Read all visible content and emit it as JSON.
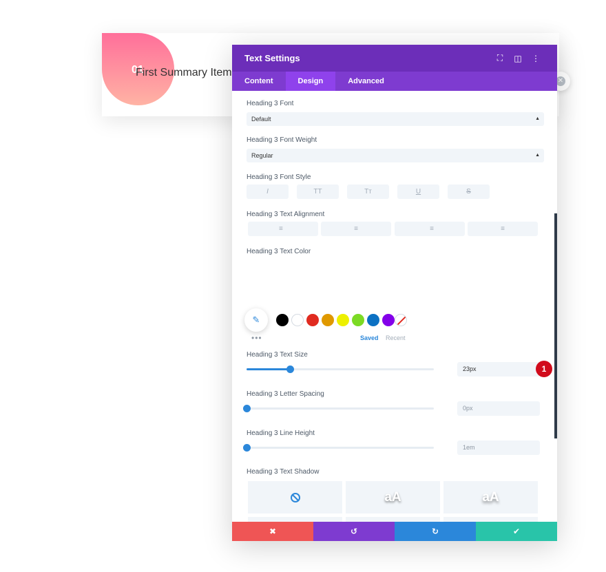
{
  "card": {
    "number": "01",
    "title": "First Summary Item",
    "close_glyph": "✕"
  },
  "modal": {
    "title": "Text Settings",
    "header_icons": [
      "expand-icon",
      "sidebar-icon",
      "more-icon"
    ],
    "header_glyphs": {
      "expand": "⛶",
      "sidebar": "◫",
      "more": "⋮"
    },
    "tabs": [
      {
        "label": "Content",
        "active": false
      },
      {
        "label": "Design",
        "active": true
      },
      {
        "label": "Advanced",
        "active": false
      }
    ]
  },
  "fields": {
    "font": {
      "label": "Heading 3 Font",
      "value": "Default"
    },
    "weight": {
      "label": "Heading 3 Font Weight",
      "value": "Regular"
    },
    "style": {
      "label": "Heading 3 Font Style",
      "options": [
        {
          "name": "italic",
          "glyph": "I"
        },
        {
          "name": "uppercase",
          "glyph": "TT"
        },
        {
          "name": "capitalize",
          "glyph": "Tт"
        },
        {
          "name": "underline",
          "glyph": "U"
        },
        {
          "name": "strikethrough",
          "glyph": "S"
        }
      ]
    },
    "alignment": {
      "label": "Heading 3 Text Alignment",
      "options": [
        {
          "name": "left",
          "glyph": "≡"
        },
        {
          "name": "center",
          "glyph": "≡"
        },
        {
          "name": "right",
          "glyph": "≡"
        },
        {
          "name": "justify",
          "glyph": "≡"
        }
      ]
    },
    "color": {
      "label": "Heading 3 Text Color",
      "eyedropper_glyph": "✎",
      "swatches": [
        "#000000",
        "#ffffff",
        "#e02b20",
        "#e09900",
        "#edf000",
        "#7cda24",
        "#0c71c3",
        "#8300e9"
      ],
      "more": "•••",
      "saved": "Saved",
      "recent": "Recent"
    },
    "size": {
      "label": "Heading 3 Text Size",
      "value": "23px",
      "slider_fraction": 0.23,
      "badge": "1"
    },
    "letter_spacing": {
      "label": "Heading 3 Letter Spacing",
      "value": "0px",
      "slider_fraction": 0.0
    },
    "line_height": {
      "label": "Heading 3 Line Height",
      "value": "1em",
      "slider_fraction": 0.0
    },
    "shadow": {
      "label": "Heading 3 Text Shadow",
      "preview_text": "aA"
    }
  },
  "footer": {
    "cancel_glyph": "✖",
    "undo_glyph": "↺",
    "redo_glyph": "↻",
    "save_glyph": "✔",
    "colors": {
      "cancel": "#ef5555",
      "undo": "#7e3bd0",
      "redo": "#2b87da",
      "save": "#29c4a9"
    }
  },
  "accent": "#2b87da"
}
